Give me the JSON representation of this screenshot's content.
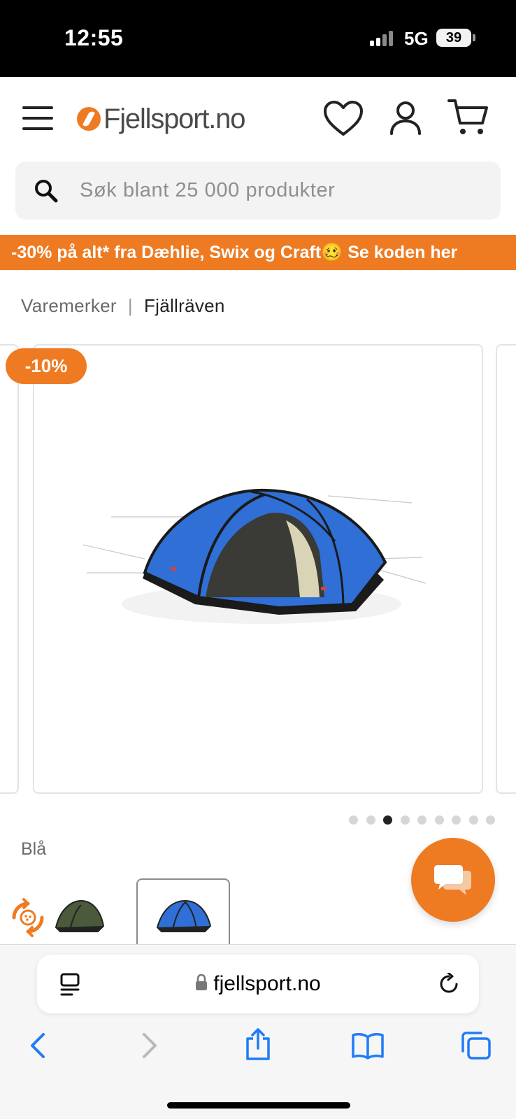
{
  "status_bar": {
    "time": "12:55",
    "network": "5G",
    "battery": "39"
  },
  "header": {
    "logo_text": "Fjellsport.no",
    "icons": [
      "menu-icon",
      "heart-icon",
      "user-icon",
      "cart-icon"
    ]
  },
  "search": {
    "placeholder": "Søk blant 25 000 produkter",
    "value": ""
  },
  "promo": {
    "text": "-30% på alt* fra Dæhlie, Swix og Craft🥴 Se koden her"
  },
  "breadcrumb": {
    "parent": "Varemerker",
    "separator": "|",
    "current": "Fjällräven"
  },
  "product": {
    "discount_badge": "-10%",
    "image_count": 9,
    "active_image_index": 3
  },
  "color_selector": {
    "label": "Blå",
    "swatches": [
      {
        "name": "green",
        "color": "#4a5a3a",
        "selected": false
      },
      {
        "name": "blue",
        "color": "#2f6fd6",
        "selected": true
      }
    ]
  },
  "browser": {
    "url": "fjellsport.no",
    "toolbar_icons": [
      "back-icon",
      "forward-icon",
      "share-icon",
      "bookmarks-icon",
      "tabs-icon"
    ]
  },
  "colors": {
    "brand_orange": "#ee7b22",
    "ios_blue": "#1f7cf6",
    "tent_blue": "#2f6fd6"
  }
}
